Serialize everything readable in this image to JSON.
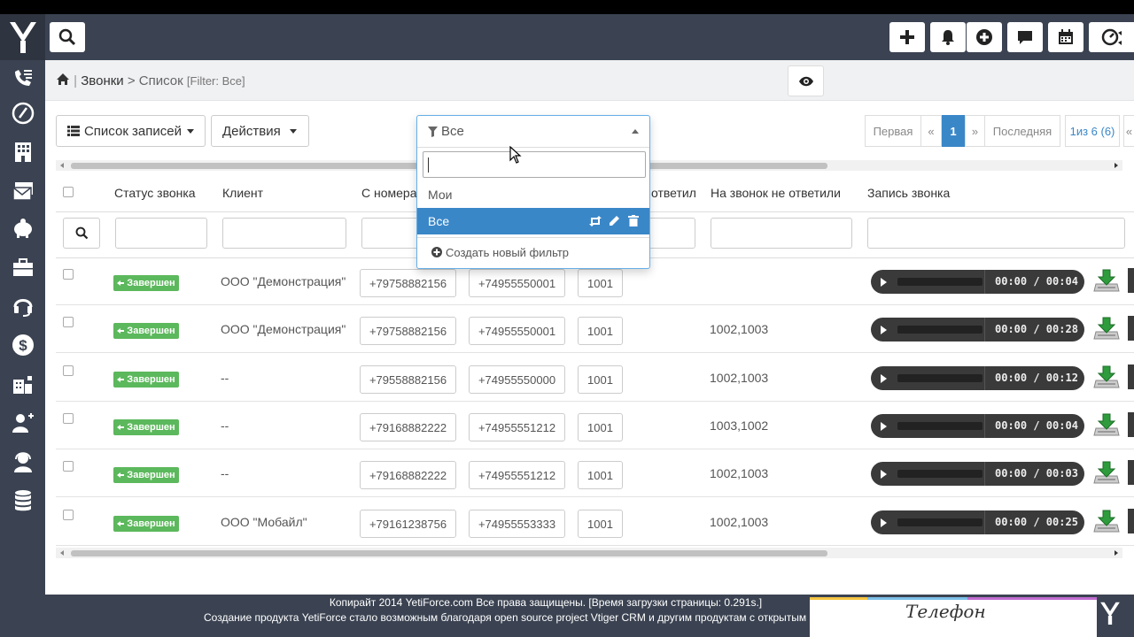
{
  "header": {
    "icons": [
      "plus-icon",
      "bell-icon",
      "plus-circle-icon",
      "comment-icon",
      "calendar-icon",
      "speedometer-icon"
    ]
  },
  "breadcrumb": {
    "module": "Звонки",
    "separator": ">",
    "view": "Список",
    "filter": "[Filter: Все]"
  },
  "toolbar": {
    "records_list_label": "Список записей",
    "actions_label": "Действия"
  },
  "filter_dropdown": {
    "selected": "Все",
    "search_value": "",
    "options": [
      "Мои",
      "Все"
    ],
    "active_option": "Все",
    "create_label": "Создать новый фильтр"
  },
  "pagination": {
    "first": "Первая",
    "prev": "«",
    "current": "1",
    "next": "»",
    "last": "Последняя",
    "count": "1из 6 (6)",
    "extra": "«"
  },
  "table": {
    "columns": [
      "Статус звонка",
      "Клиент",
      "С номера",
      "ответил",
      "На звонок не ответили",
      "Запись звонка"
    ],
    "rows": [
      {
        "status": "Завершен",
        "client": "ООО \"Демонстрация\"",
        "from": "+79758882156",
        "to": "+74955550001",
        "ext": "1001",
        "no_answer": "",
        "duration": "00:00 / 00:04"
      },
      {
        "status": "Завершен",
        "client": "ООО \"Демонстрация\"",
        "from": "+79758882156",
        "to": "+74955550001",
        "ext": "1001",
        "no_answer": "1002,1003",
        "duration": "00:00 / 00:28"
      },
      {
        "status": "Завершен",
        "client": "--",
        "from": "+79558882156",
        "to": "+74955550000",
        "ext": "1001",
        "no_answer": "1002,1003",
        "duration": "00:00 / 00:12"
      },
      {
        "status": "Завершен",
        "client": "--",
        "from": "+79168882222",
        "to": "+74955551212",
        "ext": "1001",
        "no_answer": "1003,1002",
        "duration": "00:00 / 00:04"
      },
      {
        "status": "Завершен",
        "client": "--",
        "from": "+79168882222",
        "to": "+74955551212",
        "ext": "1001",
        "no_answer": "1002,1003",
        "duration": "00:00 / 00:03"
      },
      {
        "status": "Завершен",
        "client": "ООО \"Мобайл\"",
        "from": "+79161238756",
        "to": "+74955553333",
        "ext": "1001",
        "no_answer": "1002,1003",
        "duration": "00:00 / 00:25"
      }
    ]
  },
  "footer": {
    "line1": "Копирайт 2014 YetiForce.com Все права защищены. [Время загрузки страницы: 0.291s.]",
    "line2": "Создание продукта YetiForce стало возможным благодаря open source project Vtiger CRM и другим продуктам с открытым и",
    "phone_label": "Телефон"
  },
  "colors": {
    "sidebar": "#3b4352",
    "accent": "#3a87c8",
    "status_success": "#5cb85c"
  }
}
